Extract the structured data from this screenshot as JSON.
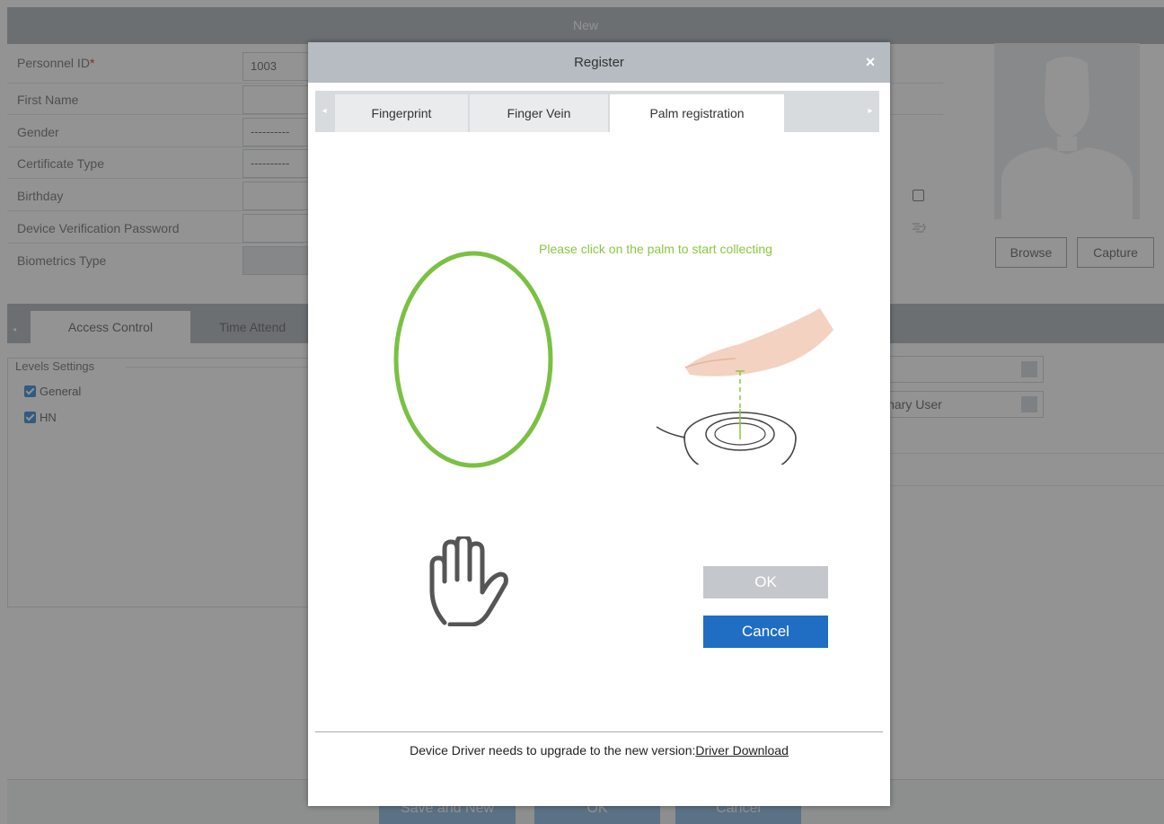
{
  "background_window": {
    "title": "New",
    "fields": {
      "personnel_id_label": "Personnel ID",
      "required_mark": "*",
      "personnel_id_value": "1003",
      "first_name_label": "First Name",
      "gender_label": "Gender",
      "gender_value": "----------",
      "certificate_type_label": "Certificate Type",
      "certificate_type_value": "----------",
      "birthday_label": "Birthday",
      "device_password_label": "Device Verification Password",
      "biometrics_type_label": "Biometrics Type"
    },
    "photo_buttons": {
      "browse": "Browse",
      "capture": "Capture"
    },
    "tabs": [
      "Access Control",
      "Time Attend"
    ],
    "levels": {
      "title": "Levels Settings",
      "items": [
        "General",
        "HN"
      ]
    },
    "right_select_2_value": "inary User",
    "footer_buttons": [
      "Save and New",
      "OK",
      "Cancel"
    ]
  },
  "modal": {
    "title": "Register",
    "tabs": [
      "Fingerprint",
      "Finger Vein",
      "Palm registration"
    ],
    "active_tab": "Palm registration",
    "prompt": "Please click on the palm to start collecting",
    "ok_label": "OK",
    "cancel_label": "Cancel",
    "driver_text": "Device Driver needs to upgrade to the new version:",
    "driver_link": "Driver Download"
  },
  "colors": {
    "prompt_green": "#8ac73f",
    "ring_green": "#7ac143",
    "primary_blue": "#1f6ec4",
    "header_gray": "#aeb6bc"
  }
}
